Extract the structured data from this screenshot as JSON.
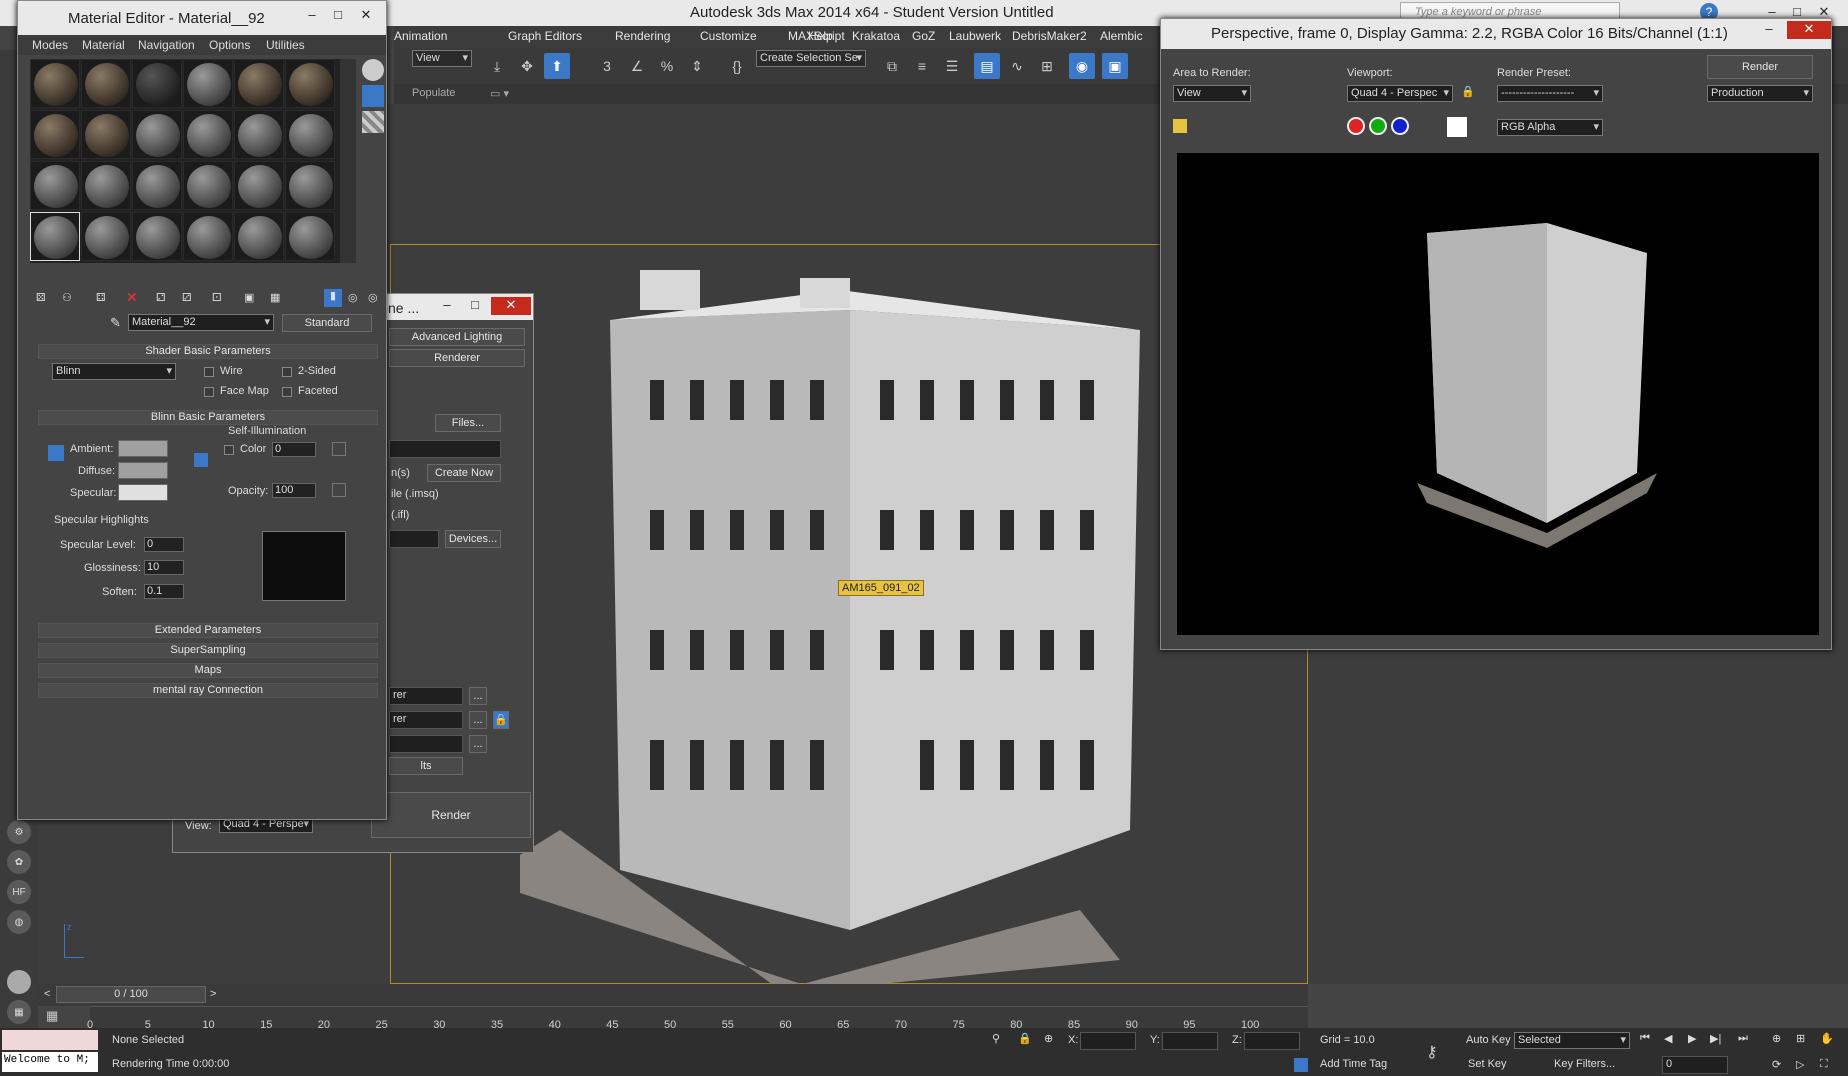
{
  "app": {
    "title": "Autodesk 3ds Max  2014 x64   - Student Version    Untitled",
    "search_placeholder": "Type a keyword or phrase"
  },
  "menubar": [
    "Animation",
    "Graph Editors",
    "Rendering",
    "Customize",
    "MAXScript",
    "Help",
    "Krakatoa",
    "GoZ",
    "Laubwerk",
    "DebrisMaker2",
    "Alembic"
  ],
  "toolbar": {
    "view_dropdown": "View",
    "selection_set": "Create Selection Se",
    "ribbon_populate": "Populate"
  },
  "viewport": {
    "tooltip": "AM165_091_02",
    "axis_label": "z"
  },
  "material_editor": {
    "title": "Material Editor - Material__92",
    "menu": [
      "Modes",
      "Material",
      "Navigation",
      "Options",
      "Utilities"
    ],
    "material_name": "Material__92",
    "material_type": "Standard",
    "shader_panel": "Shader Basic Parameters",
    "shader": "Blinn",
    "wire": "Wire",
    "two_sided": "2-Sided",
    "face_map": "Face Map",
    "faceted": "Faceted",
    "blinn_panel": "Blinn Basic Parameters",
    "self_illum": "Self-Illumination",
    "color": "Color",
    "color_val": "0",
    "ambient": "Ambient:",
    "diffuse": "Diffuse:",
    "specular": "Specular:",
    "opacity": "Opacity:",
    "opacity_val": "100",
    "spec_highlights": "Specular Highlights",
    "spec_level": "Specular Level:",
    "spec_level_val": "0",
    "glossiness": "Glossiness:",
    "glossiness_val": "10",
    "soften": "Soften:",
    "soften_val": "0.1",
    "rollouts": [
      "Extended Parameters",
      "SuperSampling",
      "Maps",
      "mental ray Connection"
    ]
  },
  "render_setup": {
    "title": "ne ...",
    "tab1": "Advanced Lighting",
    "tab2": "Renderer",
    "files": "Files...",
    "ns": "n(s)",
    "create_now": "Create Now",
    "imsq": "ile (.imsq)",
    "ifl": "(.ifl)",
    "devices": "Devices...",
    "rer1": "rer",
    "rer2": "rer",
    "its": "lts",
    "view_label": "View:",
    "view_val": "Quad 4 - Perspe",
    "render_btn": "Render"
  },
  "render_frame": {
    "title": "Perspective, frame 0, Display Gamma: 2.2, RGBA Color 16 Bits/Channel (1:1)",
    "area_label": "Area to Render:",
    "area_val": "View",
    "viewport_label": "Viewport:",
    "viewport_val": "Quad 4 - Perspec",
    "preset_label": "Render Preset:",
    "preset_val": "--------------------",
    "render_btn": "Render",
    "production": "Production",
    "channel": "RGB Alpha"
  },
  "timeline": {
    "frame": "0 / 100",
    "ticks": [
      "0",
      "5",
      "10",
      "15",
      "20",
      "25",
      "30",
      "35",
      "40",
      "45",
      "50",
      "55",
      "60",
      "65",
      "70",
      "75",
      "80",
      "85",
      "90",
      "95",
      "100"
    ]
  },
  "status": {
    "listener": "Welcome to M;",
    "selection": "None Selected",
    "rendering_time": "Rendering Time  0:00:00",
    "x_label": "X:",
    "y_label": "Y:",
    "z_label": "Z:",
    "grid": "Grid = 10.0",
    "add_time_tag": "Add Time Tag",
    "auto_key": "Auto Key",
    "set_key": "Set Key",
    "selected": "Selected",
    "key_filters": "Key Filters...",
    "frame_field": "0"
  },
  "colors": {
    "accent": "#3c78c8",
    "viewport_border": "#b08d2b",
    "tooltip_bg": "#e6c440"
  }
}
